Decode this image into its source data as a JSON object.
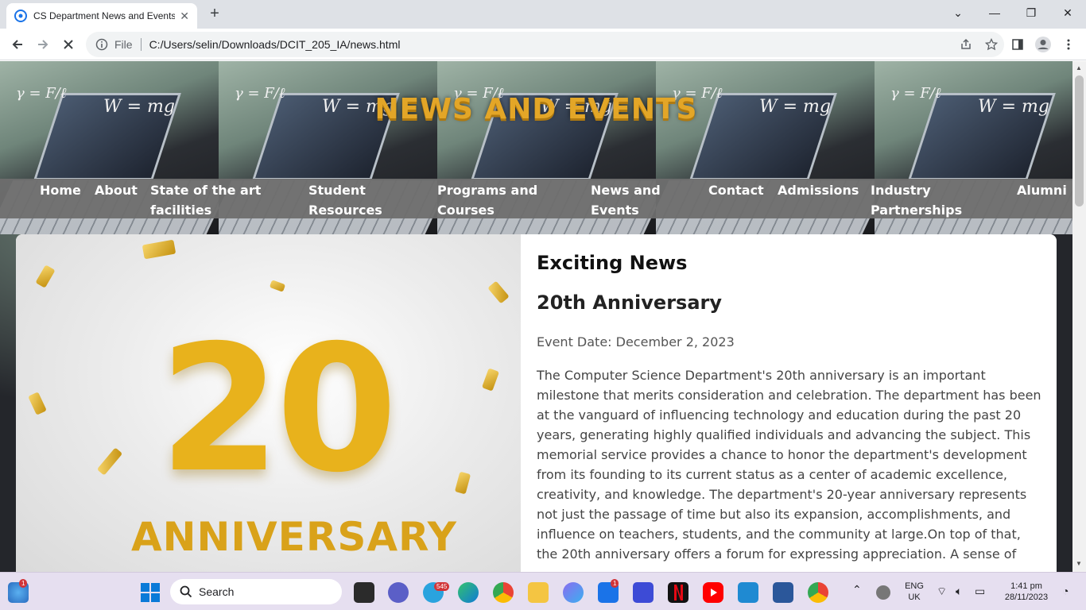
{
  "browser": {
    "tab_title": "CS Department News and Events",
    "address_scheme": "File",
    "address_url": "C:/Users/selin/Downloads/DCIT_205_IA/news.html"
  },
  "page": {
    "title": "NEWS AND EVENTS",
    "nav": [
      {
        "label": "Home"
      },
      {
        "label": "About"
      },
      {
        "label": "State of the art facilities"
      },
      {
        "label": "Student Resources"
      },
      {
        "label": "Programs and Courses"
      },
      {
        "label": "News and Events"
      },
      {
        "label": "Contact"
      },
      {
        "label": "Admissions"
      },
      {
        "label": "Industry Partnerships"
      },
      {
        "label": "Alumni"
      }
    ],
    "article": {
      "image_number": "20",
      "image_word": "ANNIVERSARY",
      "heading": "Exciting News",
      "subheading": "20th Anniversary",
      "date": "Event Date: December 2, 2023",
      "body": "The Computer Science Department's 20th anniversary is an important milestone that merits consideration and celebration. The department has been at the vanguard of influencing technology and education during the past 20 years, generating highly qualified individuals and advancing the subject. This memorial service provides a chance to honor the department's development from its founding to its current status as a center of academic excellence, creativity, and knowledge. The department's 20-year anniversary represents not just the passage of time but also its expansion, accomplishments, and influence on teachers, students, and the community at large.On top of that, the 20th anniversary offers a forum for expressing appreciation. A sense of"
    }
  },
  "taskbar": {
    "search_label": "Search",
    "widgets_badge": "1",
    "telegram_badge": "545",
    "mail_badge": "1",
    "lang_line1": "ENG",
    "lang_line2": "UK",
    "time": "1:41 pm",
    "date": "28/11/2023"
  }
}
